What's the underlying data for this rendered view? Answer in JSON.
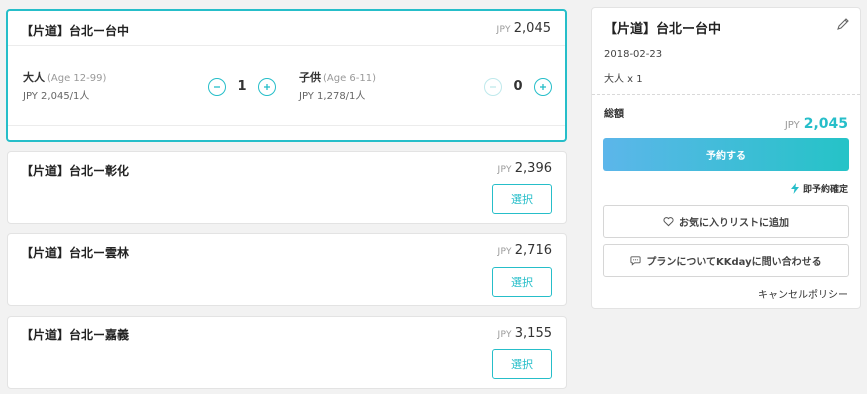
{
  "options": [
    {
      "title": "【片道】台北ー台中",
      "currency": "JPY",
      "price": "2,045",
      "adult": {
        "label": "大人",
        "age": "(Age 12-99)",
        "unit_price": "JPY 2,045/1人",
        "qty": "1"
      },
      "child": {
        "label": "子供",
        "age": "(Age 6-11)",
        "unit_price": "JPY 1,278/1人",
        "qty": "0"
      }
    },
    {
      "title": "【片道】台北ー彰化",
      "currency": "JPY",
      "price": "2,396",
      "select_label": "選択"
    },
    {
      "title": "【片道】台北ー雲林",
      "currency": "JPY",
      "price": "2,716",
      "select_label": "選択"
    },
    {
      "title": "【片道】台北ー嘉義",
      "currency": "JPY",
      "price": "3,155",
      "select_label": "選択"
    }
  ],
  "summary": {
    "title": "【片道】台北ー台中",
    "date": "2018-02-23",
    "pax": "大人 x 1",
    "total_label": "総額",
    "currency": "JPY",
    "total": "2,045",
    "book_label": "予約する",
    "instant_label": "即予約確定",
    "wishlist_label": "お気に入りリストに追加",
    "contact_label": "プランについてKKdayに問い合わせる",
    "cancel_policy_label": "キャンセルポリシー"
  },
  "colors": {
    "accent": "#26bec9",
    "gradient_start": "#5cb6ea",
    "gradient_end": "#25c3c7"
  },
  "icons": {
    "edit": "pencil-icon",
    "minus": "minus-circle-icon",
    "plus": "plus-circle-icon",
    "instant": "lightning-icon",
    "wishlist": "heart-icon",
    "contact": "chat-icon"
  }
}
